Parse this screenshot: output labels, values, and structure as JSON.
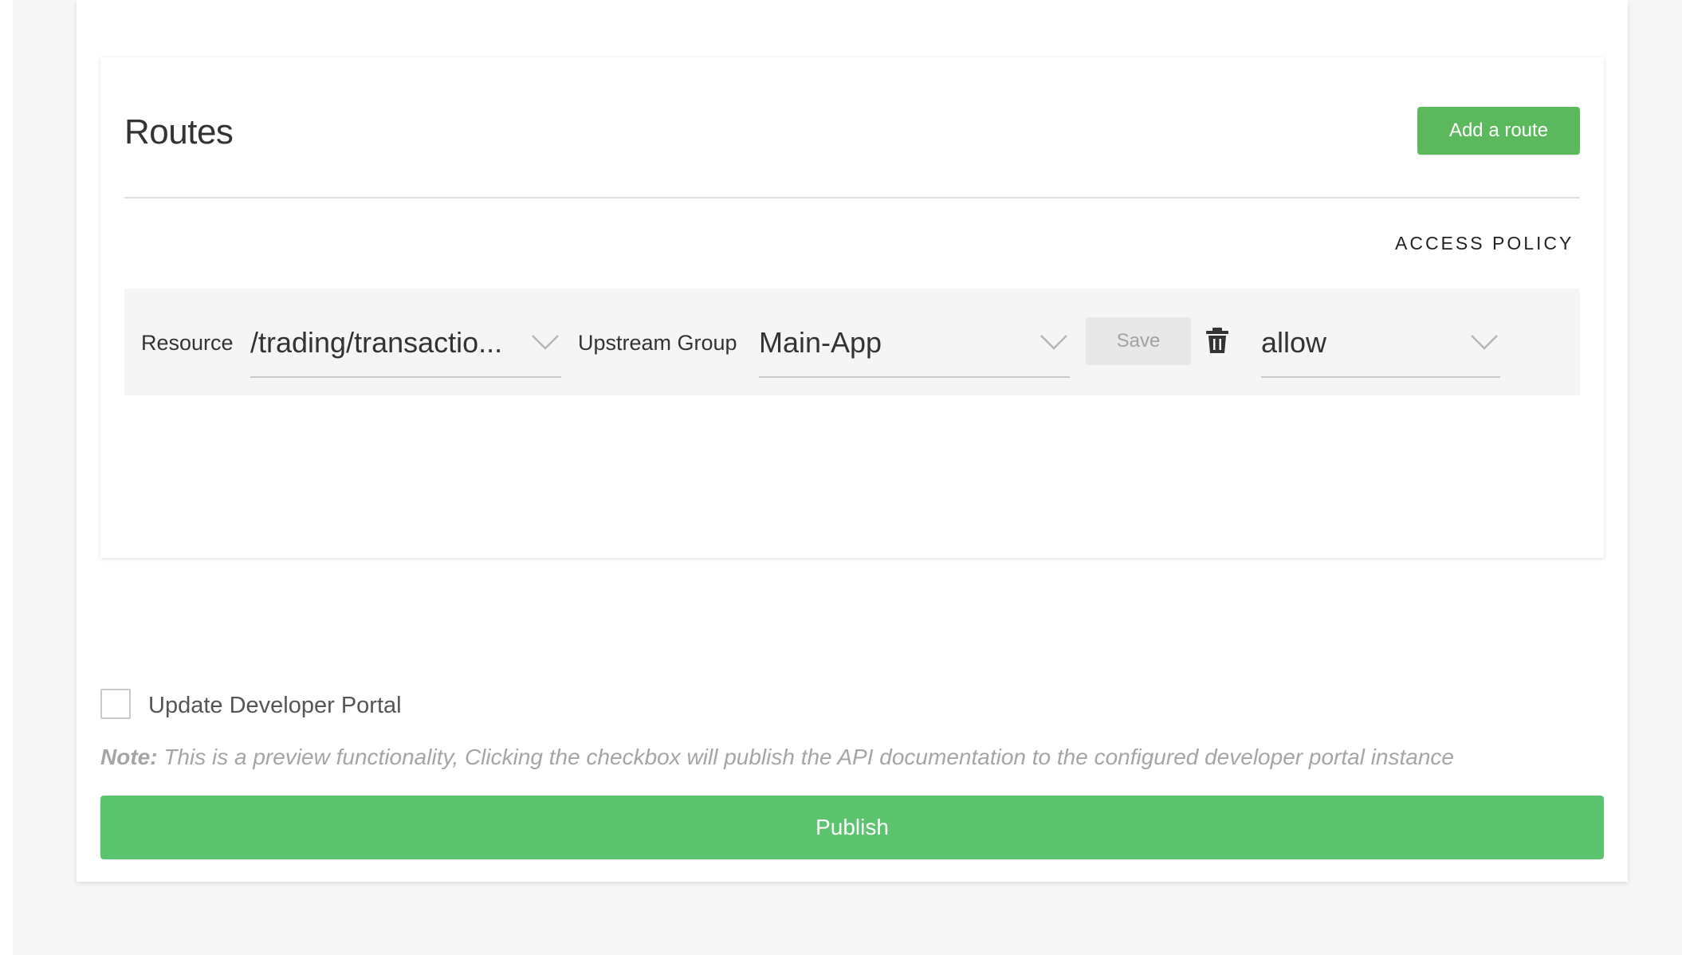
{
  "routes": {
    "title": "Routes",
    "add_route_label": "Add a route",
    "access_policy_heading": "ACCESS POLICY",
    "rows": [
      {
        "resource_label": "Resource",
        "resource_value": "/trading/transactio...",
        "upstream_label": "Upstream Group",
        "upstream_value": "Main-App",
        "save_label": "Save",
        "policy_value": "allow"
      }
    ]
  },
  "portal": {
    "checkbox_label": "Update Developer Portal",
    "checked": false,
    "note_prefix": "Note:",
    "note_text": " This is a preview functionality, Clicking the checkbox will publish the API documentation to the configured developer portal instance"
  },
  "publish_label": "Publish",
  "colors": {
    "accent_green": "#5cb85c",
    "publish_green": "#5cc46e",
    "row_background": "#f5f5f5",
    "page_background": "#f7f7f7"
  },
  "icons": {
    "dropdown": "chevron-down-icon",
    "delete": "trash-icon"
  }
}
